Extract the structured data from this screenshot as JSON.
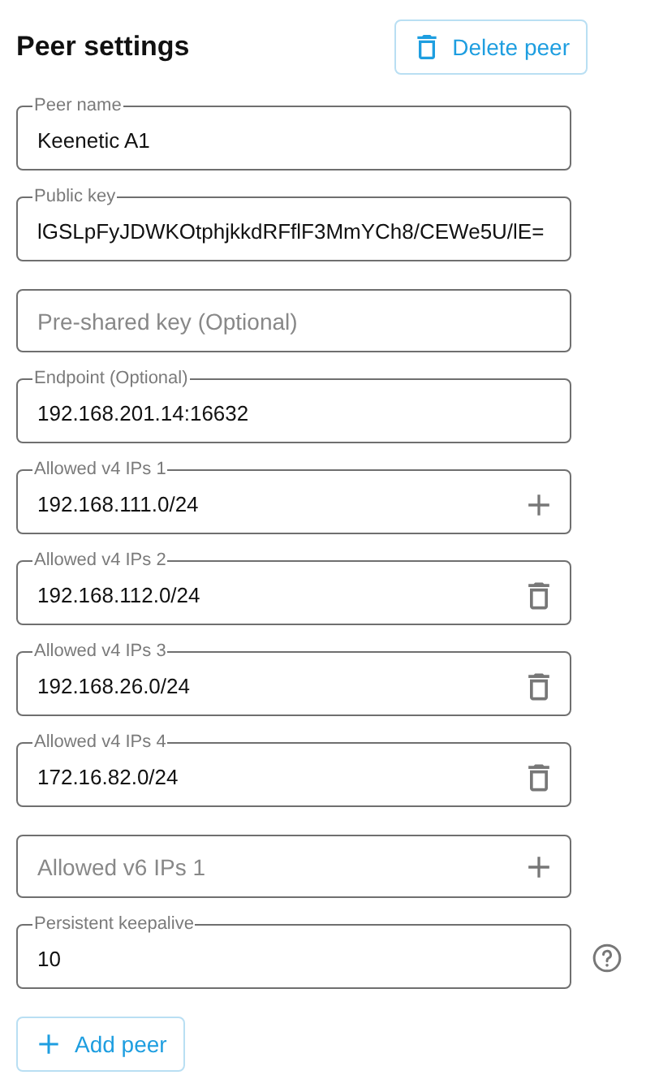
{
  "header": {
    "title": "Peer settings",
    "delete_button": "Delete peer"
  },
  "fields": [
    {
      "kind": "plain",
      "label": "Peer name",
      "value": "Keenetic A1"
    },
    {
      "kind": "plain",
      "label": "Public key",
      "value": "lGSLpFyJDWKOtphjkkdRFflF3MmYCh8/CEWe5U/lE="
    },
    {
      "kind": "plain",
      "placeholder": "Pre-shared key (Optional)"
    },
    {
      "kind": "plain",
      "label": "Endpoint (Optional)",
      "value": "192.168.201.14:16632"
    },
    {
      "kind": "add",
      "label": "Allowed v4 IPs 1",
      "value": "192.168.111.0/24"
    },
    {
      "kind": "delete",
      "label": "Allowed v4 IPs 2",
      "value": "192.168.112.0/24"
    },
    {
      "kind": "delete",
      "label": "Allowed v4 IPs 3",
      "value": "192.168.26.0/24"
    },
    {
      "kind": "delete",
      "label": "Allowed v4 IPs 4",
      "value": "172.16.82.0/24"
    },
    {
      "kind": "add",
      "placeholder": "Allowed v6 IPs 1"
    },
    {
      "kind": "plain",
      "label": "Persistent keepalive",
      "value": "10",
      "help": true
    }
  ],
  "add_button": "Add peer"
}
